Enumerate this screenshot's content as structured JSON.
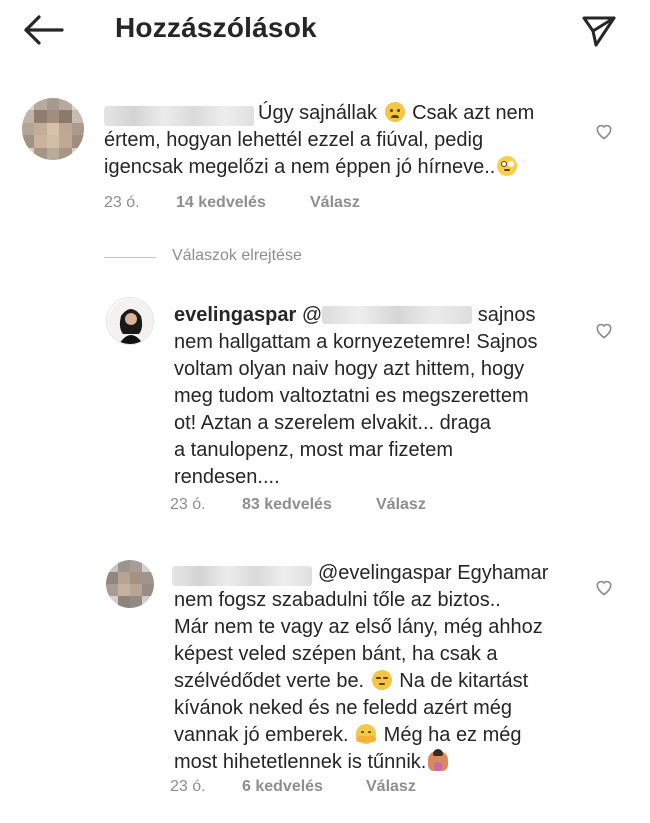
{
  "header": {
    "title": "Hozzászólások",
    "back_icon": "arrow-left-icon",
    "send_icon": "paper-plane-icon"
  },
  "colors": {
    "text": "#262626",
    "meta": "#8e8e8e",
    "divider": "#c7c7c7"
  },
  "comments": [
    {
      "username": "",
      "username_redacted": true,
      "lines": [
        "Úgy sajnállak",
        "Csak azt nem",
        "értem, hogyan lehettél ezzel a fiúval, pedig",
        "igencsak megelőzi a nem éppen jó hírneve.."
      ],
      "emojis": [
        "sad-face-emoji",
        "eye-roll-emoji"
      ],
      "time": "23 ó.",
      "likes": "14 kedvelés",
      "reply": "Válasz"
    },
    {
      "username": "evelingaspar",
      "mention": "@",
      "mention_redacted": true,
      "lines": [
        "sajnos",
        "nem hallgattam a kornyezetemre! Sajnos",
        "voltam olyan naiv hogy azt hittem, hogy",
        "meg tudom valtoztatni es megszerettem",
        "ot! Aztan a szerelem elvakit... draga",
        "a tanulopenz, most mar fizetem",
        "rendesen...."
      ],
      "time": "23 ó.",
      "likes": "83 kedvelés",
      "reply": "Válasz"
    },
    {
      "username": "",
      "username_redacted": true,
      "mention": "@evelingaspar",
      "lines": [
        "Egyhamar",
        "nem fogsz szabadulni tőle az biztos..",
        "Már nem te vagy az első lány, még ahhoz",
        "képest veled szépen bánt, ha csak a",
        "szélvédődet verte be.",
        "Na de kitartást",
        "kívánok neked és ne feledd azért még",
        "vannak jó emberek.",
        "Még ha ez még",
        "most hihetetlennek is tűnnik."
      ],
      "emojis": [
        "unamused-face-emoji",
        "hugging-face-emoji",
        "person-shrugging-emoji"
      ],
      "time": "23 ó.",
      "likes": "6 kedvelés",
      "reply": "Válasz"
    }
  ],
  "hide_replies": "Válaszok elrejtése"
}
